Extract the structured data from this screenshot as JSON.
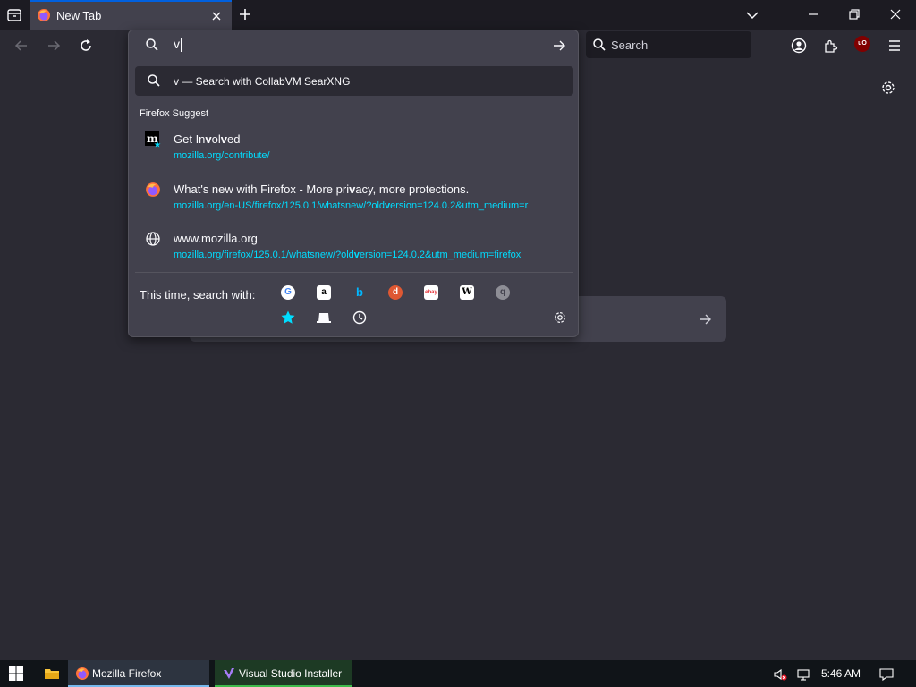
{
  "tabs": [
    {
      "title": "New Tab",
      "active": true
    }
  ],
  "navbar": {
    "search_placeholder": "Search"
  },
  "urlbar": {
    "input_value": "v",
    "heuristic_result": "v — Search with CollabVM SearXNG",
    "group_label": "Firefox Suggest",
    "results": [
      {
        "title_parts": [
          "Get In",
          "v",
          "ol",
          "v",
          "ed"
        ],
        "url": "mozilla.org/contribute/",
        "icon": "mozilla-m-icon"
      },
      {
        "title_parts": [
          "What's new with Firefox - More pri",
          "v",
          "acy, more protections."
        ],
        "url_parts": [
          "mozilla.org/en-US/firefox/125.0.1/whatsnew/?old",
          "v",
          "ersion=124.0.2&utm_medium=r"
        ],
        "icon": "firefox-icon"
      },
      {
        "title_parts": [
          "www.mozilla.org"
        ],
        "url_parts": [
          "mozilla.org/firefox/125.0.1/whatsnew/?old",
          "v",
          "ersion=124.0.2&utm_medium=firefox"
        ],
        "icon": "globe-icon"
      }
    ],
    "oneoff_label": "This time, search with:",
    "engines": [
      {
        "name": "google-engine-icon",
        "glyph": "G"
      },
      {
        "name": "amazon-engine-icon",
        "glyph": "a"
      },
      {
        "name": "bing-engine-icon",
        "glyph": "b"
      },
      {
        "name": "duckduckgo-engine-icon",
        "glyph": "d"
      },
      {
        "name": "ebay-engine-icon",
        "glyph": "ebay"
      },
      {
        "name": "wikipedia-engine-icon",
        "glyph": "W"
      },
      {
        "name": "searxng-engine-icon",
        "glyph": "q"
      }
    ],
    "modes": [
      {
        "name": "bookmarks-mode-icon"
      },
      {
        "name": "tabs-mode-icon"
      },
      {
        "name": "history-mode-icon"
      }
    ]
  },
  "taskbar": {
    "tasks": [
      {
        "label": "Mozilla Firefox",
        "icon": "firefox-icon",
        "bar_color": "#76b9ed"
      },
      {
        "label": "Visual Studio Installer",
        "icon": "visual-studio-icon",
        "bar_color": "#3dbb4b"
      }
    ],
    "clock": "5:46 AM"
  },
  "colors": {
    "accent": "#0060df",
    "link": "#00ddff",
    "popup_bg": "#42414d",
    "page_bg": "#2b2a33",
    "tabstrip_bg": "#1c1b22"
  }
}
